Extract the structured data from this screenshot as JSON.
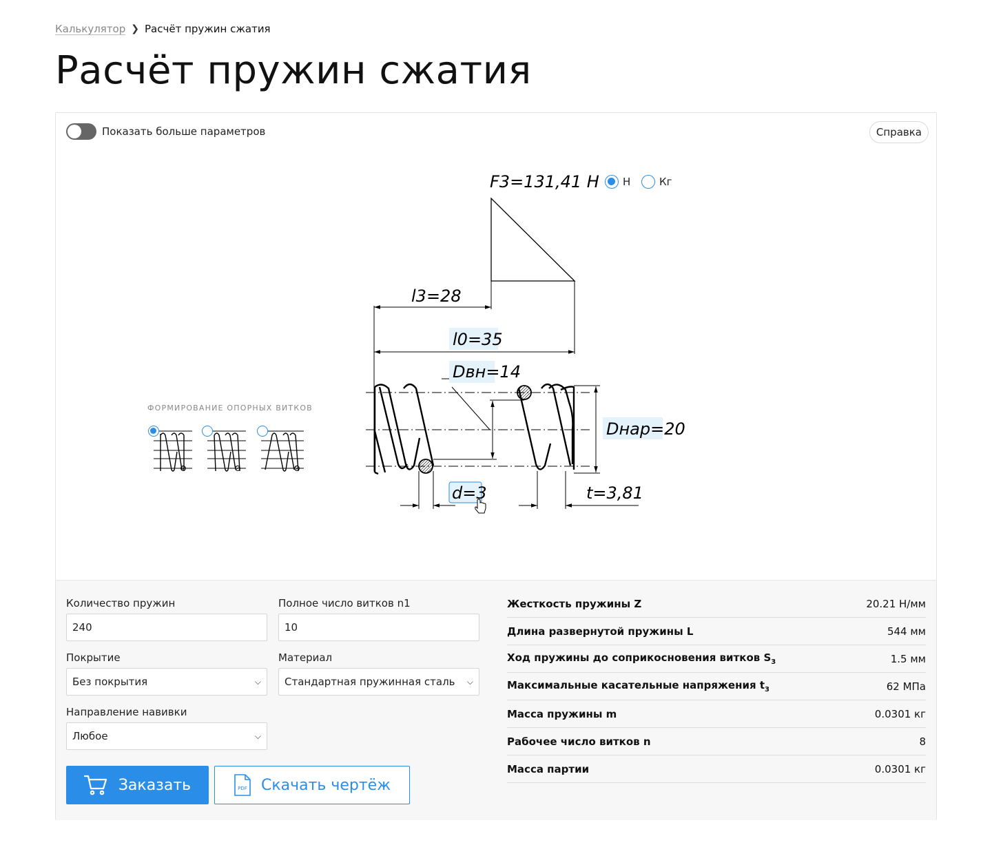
{
  "breadcrumb": {
    "link": "Калькулятор",
    "current": "Расчёт пружин сжатия"
  },
  "page_title": "Расчёт пружин сжатия",
  "toggle": {
    "label": "Показать больше параметров",
    "on": false
  },
  "help_button": "Справка",
  "units": {
    "options": [
      "Н",
      "Кг"
    ],
    "selected": "Н"
  },
  "drawing": {
    "force": "F3=131,41 H",
    "l3": "l3=28",
    "l0": "l0=35",
    "d_inner": "Dвн=14",
    "d_outer": "Dнар=20",
    "wire_d": "d=3",
    "pitch": "t=3,81"
  },
  "support_coils": {
    "caption": "ФОРМИРОВАНИЕ ОПОРНЫХ ВИТКОВ",
    "selected_index": 0
  },
  "form": {
    "quantity": {
      "label": "Количество пружин",
      "value": "240"
    },
    "total_coils": {
      "label": "Полное число витков n1",
      "value": "10"
    },
    "coating": {
      "label": "Покрытие",
      "value": "Без покрытия"
    },
    "material": {
      "label": "Материал",
      "value": "Стандартная пружинная сталь"
    },
    "winding": {
      "label": "Направление навивки",
      "value": "Любое"
    }
  },
  "buttons": {
    "order": "Заказать",
    "download": "Скачать чертёж",
    "pdf_badge": "PDF"
  },
  "results": [
    {
      "label": "Жесткость пружины Z",
      "sub": "",
      "value": "20.21 Н/мм"
    },
    {
      "label": "Длина развернутой пружины L",
      "sub": "",
      "value": "544 мм"
    },
    {
      "label": "Ход пружины до соприкосновения витков S",
      "sub": "3",
      "value": "1.5 мм"
    },
    {
      "label": "Максимальные касательные напряжения t",
      "sub": "3",
      "value": "62 МПа"
    },
    {
      "label": "Масса пружины m",
      "sub": "",
      "value": "0.0301 кг"
    },
    {
      "label": "Рабочее число витков n",
      "sub": "",
      "value": "8"
    },
    {
      "label": "Масса партии",
      "sub": "",
      "value": "0.0301 кг"
    }
  ],
  "colors": {
    "accent": "#2a8ee9",
    "highlight": "#e4f2fc"
  }
}
